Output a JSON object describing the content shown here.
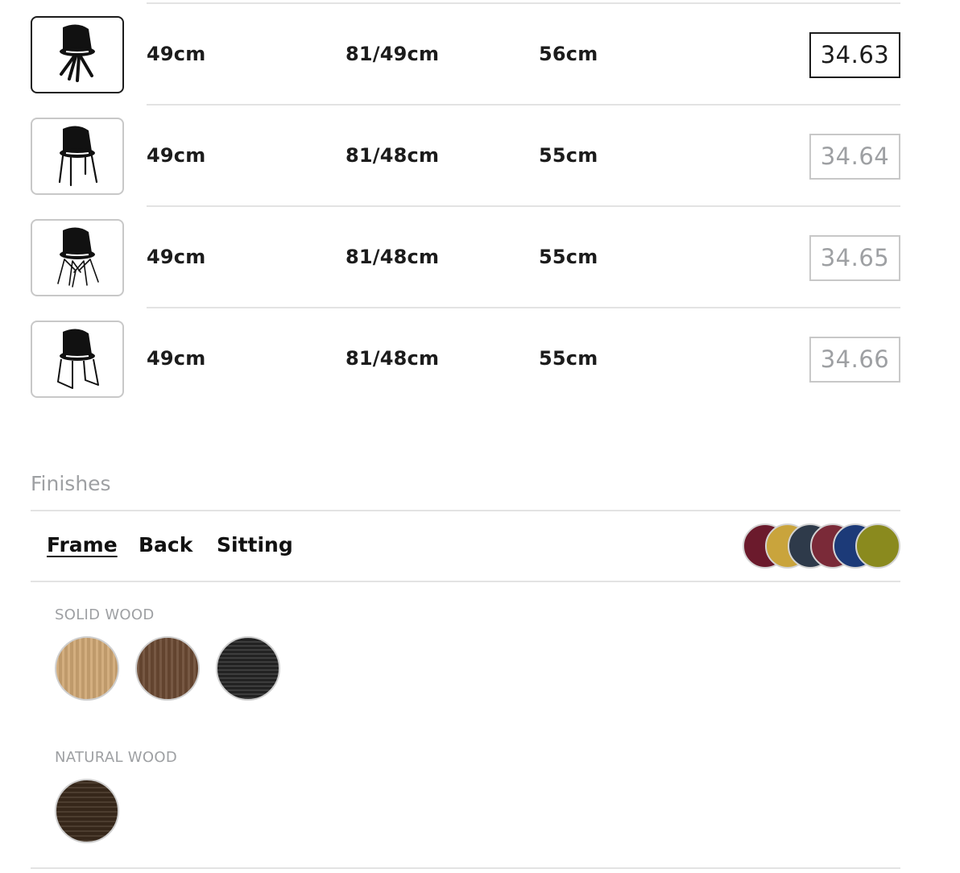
{
  "products": [
    {
      "width": "49cm",
      "height": "81/49cm",
      "depth": "56cm",
      "code": "34.63",
      "selected": true,
      "icon": "swivel-chair-icon"
    },
    {
      "width": "49cm",
      "height": "81/48cm",
      "depth": "55cm",
      "code": "34.64",
      "selected": false,
      "icon": "four-leg-chair-icon"
    },
    {
      "width": "49cm",
      "height": "81/48cm",
      "depth": "55cm",
      "code": "34.65",
      "selected": false,
      "icon": "wire-base-chair-icon"
    },
    {
      "width": "49cm",
      "height": "81/48cm",
      "depth": "55cm",
      "code": "34.66",
      "selected": false,
      "icon": "sled-base-chair-icon"
    }
  ],
  "finishes": {
    "title": "Finishes",
    "tabs": [
      {
        "label": "Frame",
        "active": true
      },
      {
        "label": "Back",
        "active": false
      },
      {
        "label": "Sitting",
        "active": false
      }
    ],
    "fabric_colors": [
      "#6b1a2c",
      "#c9a43c",
      "#2e3a4a",
      "#7a2a38",
      "#1c3a78",
      "#8a8a1e"
    ],
    "groups": [
      {
        "label": "SOLID WOOD",
        "swatches": [
          {
            "name": "light-oak",
            "color": "#cfa774"
          },
          {
            "name": "walnut",
            "color": "#6b4a33"
          },
          {
            "name": "black-stained",
            "color": "#2e2e2e"
          }
        ]
      },
      {
        "label": "NATURAL WOOD",
        "swatches": [
          {
            "name": "dark-wood",
            "color": "#3f2e1f"
          }
        ]
      }
    ]
  }
}
